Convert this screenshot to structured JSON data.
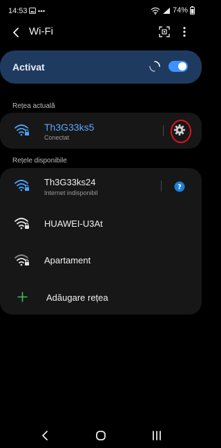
{
  "status_bar": {
    "time": "14:53",
    "battery_percent": "74%",
    "icons": [
      "gallery-icon",
      "more-notifications-icon",
      "wifi-signal-icon",
      "cell-signal-icon",
      "battery-icon"
    ]
  },
  "header": {
    "title": "Wi-Fi"
  },
  "toggle": {
    "label": "Activat",
    "enabled": true
  },
  "current_network": {
    "section_label": "Rețea actuală",
    "name": "Th3G33ks5",
    "status": "Conectat"
  },
  "available": {
    "section_label": "Rețele disponibile",
    "networks": [
      {
        "name": "Th3G33ks24",
        "status": "Internet indisponibil"
      },
      {
        "name": "HUAWEI-U3At",
        "status": ""
      },
      {
        "name": "Apartament",
        "status": ""
      }
    ],
    "add_label": "Adăugare rețea"
  },
  "colors": {
    "accent": "#3e91ff",
    "toggle_card": "#1f3a5f",
    "card": "#171717",
    "highlight_ring": "#e0141e"
  }
}
